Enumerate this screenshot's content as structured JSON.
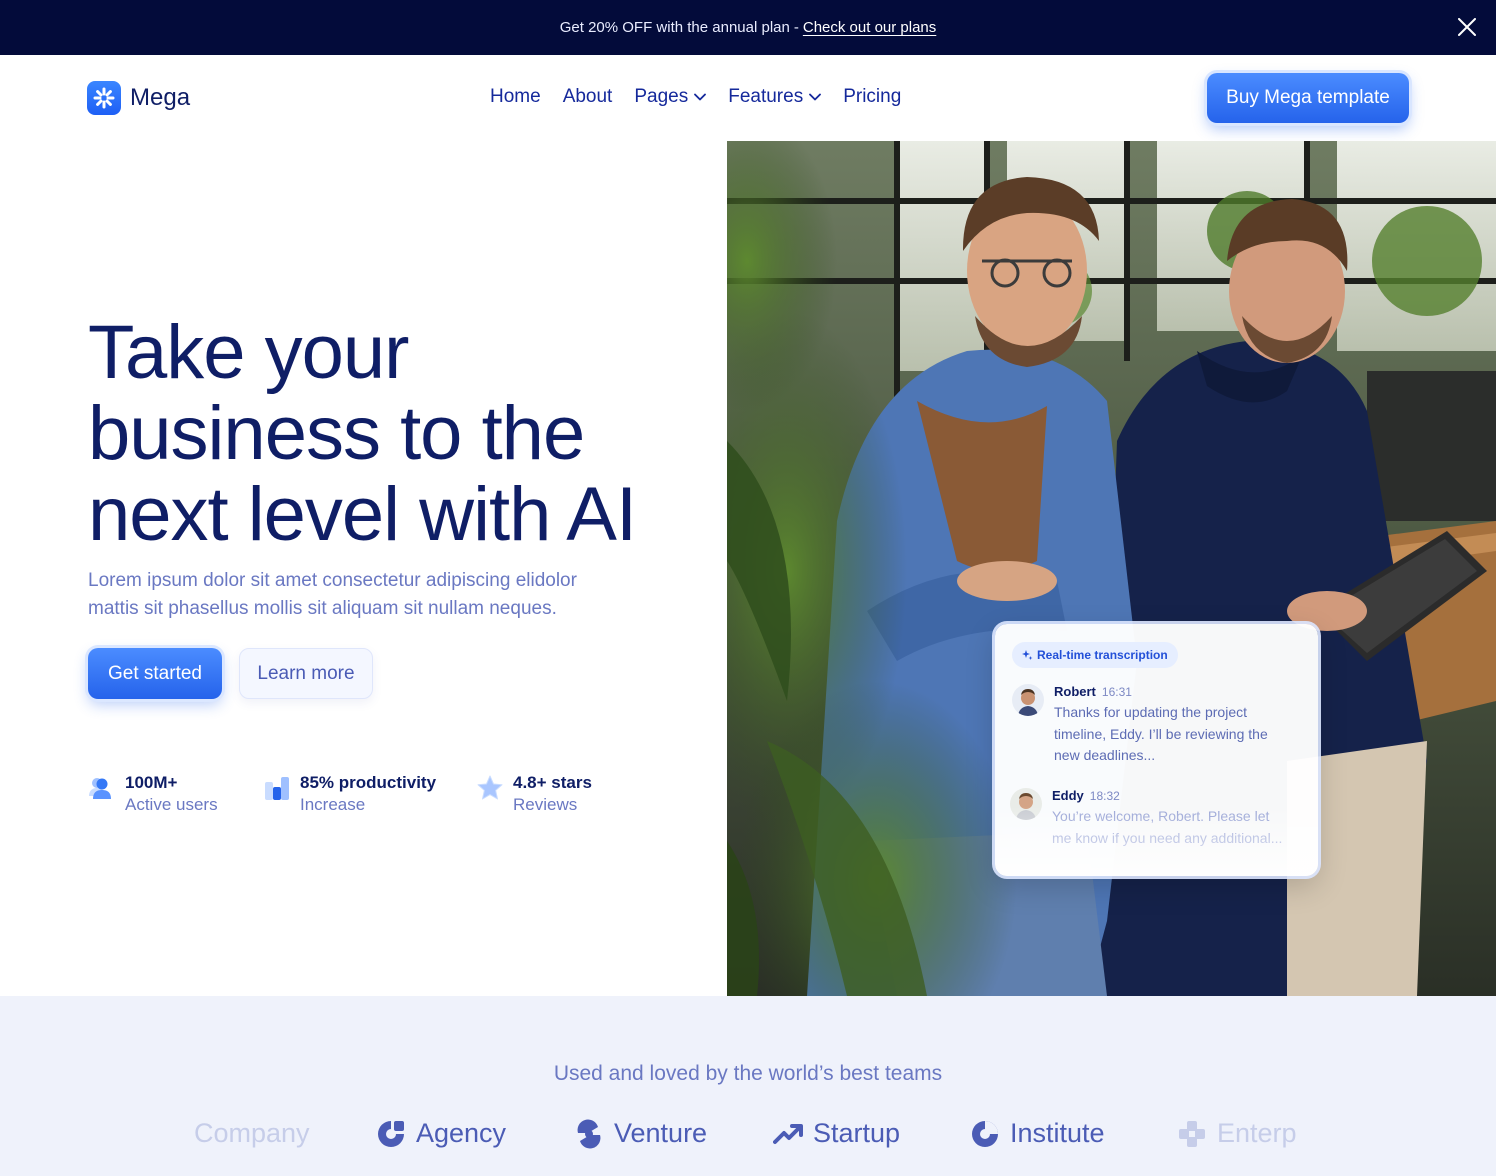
{
  "promo": {
    "text": "Get 20% OFF with the annual plan",
    "separator": "-",
    "link": "Check out our plans"
  },
  "nav": {
    "logo_text": "Mega",
    "items": [
      {
        "label": "Home"
      },
      {
        "label": "About"
      },
      {
        "label": "Pages",
        "has_dropdown": true
      },
      {
        "label": "Features",
        "has_dropdown": true
      },
      {
        "label": "Pricing"
      }
    ],
    "cta": "Buy Mega template"
  },
  "hero": {
    "title_lines": [
      "Take your",
      "business to the",
      "next level with AI"
    ],
    "subtitle_lines": [
      "Lorem ipsum dolor sit amet consectetur adipiscing elidolor",
      "mattis sit phasellus mollis sit aliquam sit nullam neques."
    ],
    "primary_button": "Get started",
    "secondary_button": "Learn more",
    "stats": [
      {
        "value": "100M+",
        "label": "Active users",
        "icon": "users-icon"
      },
      {
        "value": "85% productivity",
        "label": "Increase",
        "icon": "bar-chart-icon"
      },
      {
        "value": "4.8+ stars",
        "label": "Reviews",
        "icon": "star-icon"
      }
    ]
  },
  "transcript_card": {
    "chip": "Real-time transcription",
    "messages": [
      {
        "name": "Robert",
        "time": "16:31",
        "text": "Thanks for updating the project timeline, Eddy. I’ll be reviewing the new deadlines..."
      },
      {
        "name": "Eddy",
        "time": "18:32",
        "text": "You’re welcome, Robert. Please let me know if you need any additional..."
      }
    ]
  },
  "logos": {
    "title": "Used and loved by the world’s best teams",
    "brands": [
      "Company",
      "Agency",
      "Venture",
      "Startup",
      "Institute",
      "Enterp"
    ]
  },
  "colors": {
    "navy": "#0f1e66",
    "promo_bg": "#030b3a",
    "primary": "#2563eb",
    "muted": "#6a78c2",
    "logos_bg": "#eff2fb"
  }
}
